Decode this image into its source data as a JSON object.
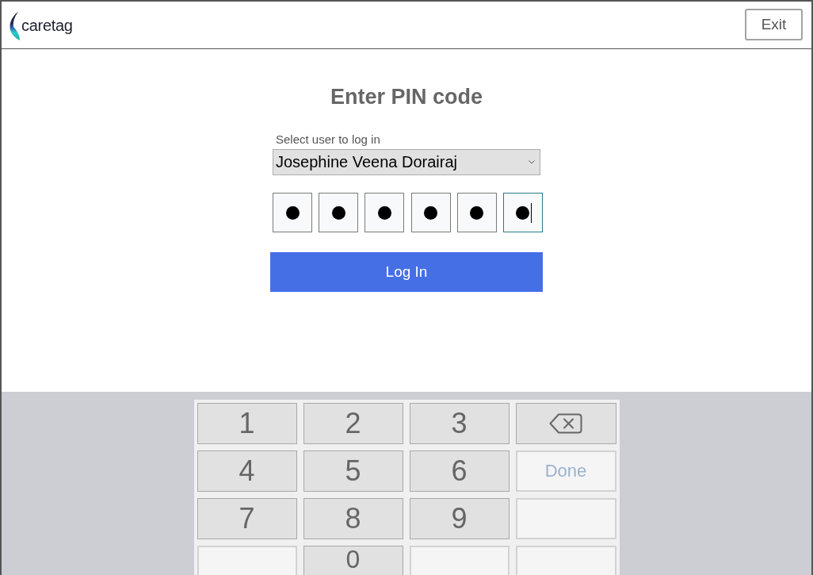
{
  "header": {
    "logo": "caretag",
    "exit_button": "Exit"
  },
  "login": {
    "title": "Enter PIN code",
    "user_label": "Select user to log in",
    "user_value": "Josephine Veena Dorairaj",
    "pin": [
      {
        "filled": true,
        "focused": false
      },
      {
        "filled": true,
        "focused": false
      },
      {
        "filled": true,
        "focused": false
      },
      {
        "filled": true,
        "focused": false
      },
      {
        "filled": true,
        "focused": false
      },
      {
        "filled": true,
        "focused": true
      }
    ],
    "login_button": "Log In"
  },
  "keypad": {
    "keys": [
      {
        "kind": "digit",
        "label": "1"
      },
      {
        "kind": "digit",
        "label": "2"
      },
      {
        "kind": "digit",
        "label": "3"
      },
      {
        "kind": "backspace"
      },
      {
        "kind": "digit",
        "label": "4"
      },
      {
        "kind": "digit",
        "label": "5"
      },
      {
        "kind": "digit",
        "label": "6"
      },
      {
        "kind": "done",
        "label": "Done",
        "disabled": true
      },
      {
        "kind": "digit",
        "label": "7"
      },
      {
        "kind": "digit",
        "label": "8"
      },
      {
        "kind": "digit",
        "label": "9"
      },
      {
        "kind": "blank"
      },
      {
        "kind": "blank"
      },
      {
        "kind": "digit",
        "label": "0"
      },
      {
        "kind": "blank"
      },
      {
        "kind": "blank"
      }
    ]
  }
}
